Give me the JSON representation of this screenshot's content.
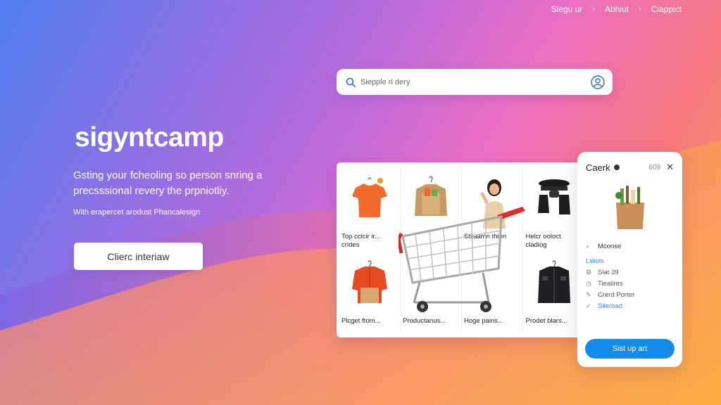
{
  "nav": {
    "items": [
      "Siegu ur",
      "Abhiut",
      "Ciappict"
    ]
  },
  "search": {
    "placeholder": "Siepple ri dery"
  },
  "hero": {
    "brand": "sigyntcamp",
    "tagline": "Gsting your fcheoling so person snring a precsssional revery the prpniotliy.",
    "subline": "With erapercet arodust Phancalesign",
    "cta_label": "Clierc interiaw"
  },
  "products": [
    {
      "label": "Top ccicir ir... crides",
      "icon": "orange-tshirt-icon"
    },
    {
      "label": "",
      "icon": "shopping-bag-clothes-icon"
    },
    {
      "label": "Stiiaamn thien",
      "icon": "woman-model-icon"
    },
    {
      "label": "Helcr ooloct cladiog",
      "icon": "black-bags-icon"
    },
    {
      "label": "Plcget ftom...",
      "icon": "red-jacket-icon"
    },
    {
      "label": "Productanus...",
      "icon": ""
    },
    {
      "label": "Hoge pains...",
      "icon": ""
    },
    {
      "label": "Prodet blars...",
      "icon": "black-shirt-icon"
    }
  ],
  "side": {
    "title": "Caerk",
    "price": "609",
    "menu": [
      {
        "label": "Mconse",
        "icon": "search-icon",
        "style": "first"
      },
      {
        "label": "Liiiiols",
        "icon": "",
        "style": "blue"
      },
      {
        "label": "Siat 39",
        "icon": "gear-icon",
        "style": ""
      },
      {
        "label": "Tiealires",
        "icon": "clock-icon",
        "style": ""
      },
      {
        "label": "Crerd Porter",
        "icon": "edit-icon",
        "style": ""
      },
      {
        "label": "Sileroad",
        "icon": "check-icon",
        "style": "blue"
      }
    ],
    "signup_label": "Sist up art"
  },
  "colors": {
    "accent": "#138bea",
    "link": "#2b8ae6"
  }
}
